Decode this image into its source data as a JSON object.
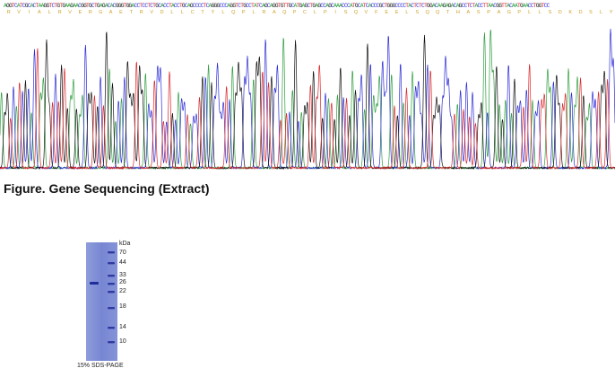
{
  "sequencing": {
    "nucleotides": "AGGTCATCGCACTAAGGTCTGTGAAGAACGGTGCTGAGACACGGGTGGACCTCCTCTGCACCTACCTGCAGCCCCTCAGGGCCCAGGTCTGCCTATCAGCAGGTGTTGCATGAGCTGAGCCAGCAAACCCATGCATCACCCGCTGGGCCCCTACTCTCTGGACAAGAGACAGCCTCTACCTTAACGGTTACAATGAACCTGGTCC",
    "amino_acids": [
      "R",
      "V",
      "I",
      "A",
      "L",
      "R",
      "V",
      "E",
      "R",
      "G",
      "A",
      "E",
      "T",
      "R",
      "V",
      "D",
      "L",
      "L",
      "C",
      "T",
      "Y",
      "L",
      "Q",
      "P",
      "L",
      "R",
      "A",
      "Q",
      "P",
      "C",
      "L",
      "P",
      "I",
      "S",
      "Q",
      "V",
      "F",
      "E",
      "E",
      "L",
      "S",
      "Q",
      "Q",
      "T",
      "H",
      "A",
      "S",
      "P",
      "A",
      "G",
      "P",
      "L",
      "L",
      "S",
      "D",
      "K",
      "D",
      "S",
      "L",
      "Y",
      "L",
      "N",
      "G",
      "Y",
      "N",
      "E",
      "P",
      "G",
      "P"
    ],
    "colors": {
      "A": "#2e9e3f",
      "C": "#2b2bd6",
      "G": "#111111",
      "T": "#d9262a",
      "aa": "#c9a227"
    }
  },
  "figure": {
    "caption": "Figure. Gene Sequencing (Extract)"
  },
  "gel": {
    "unit_label": "kDa",
    "markers": [
      "70",
      "44",
      "33",
      "26",
      "22",
      "18",
      "14",
      "10"
    ],
    "caption": "15% SDS-PAGE",
    "lane_color": "#6f7fcf",
    "band_color": "#1f2d9a"
  }
}
